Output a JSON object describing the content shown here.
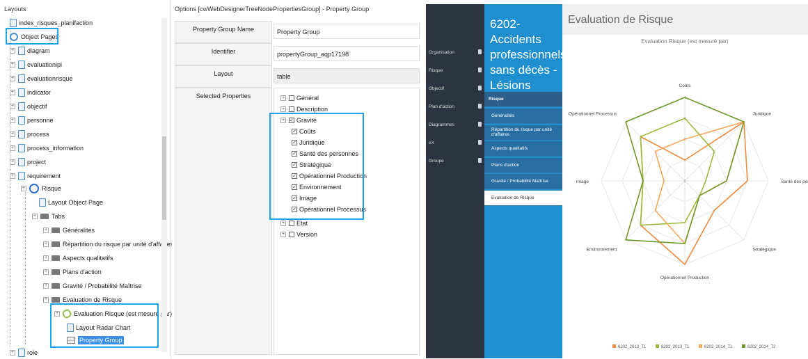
{
  "left_panel": {
    "header": "Layouts",
    "items": [
      {
        "label": "index_risques_planifaction"
      },
      {
        "label": "Object Pages"
      },
      {
        "label": "diagram"
      },
      {
        "label": "evaluationipi"
      },
      {
        "label": "evaluationrisque"
      },
      {
        "label": "indicator"
      },
      {
        "label": "objectif"
      },
      {
        "label": "personne"
      },
      {
        "label": "process"
      },
      {
        "label": "process_information"
      },
      {
        "label": "project"
      },
      {
        "label": "requirement"
      },
      {
        "label": "Risque"
      },
      {
        "label": "Layout Object Page"
      },
      {
        "label": "Tabs"
      },
      {
        "label": "Généralités"
      },
      {
        "label": "Répartition du risque par unité d'affaires"
      },
      {
        "label": "Aspects qualitatifs"
      },
      {
        "label": "Plans d'action"
      },
      {
        "label": "Gravité / Probabilité Maîtrise"
      },
      {
        "label": "Evaluation de Risque"
      },
      {
        "label": "Evaluation Risque (est mesuré par)"
      },
      {
        "label": "Layout Radar Chart"
      },
      {
        "label": "Property Group"
      },
      {
        "label": "role"
      }
    ]
  },
  "middle_panel": {
    "header": "Options [cwWebDesignerTreeNodePropertiesGroup] - Property Group",
    "fields": [
      {
        "label": "Property Group Name",
        "value": "Property Group"
      },
      {
        "label": "Identifier",
        "value": "propertyGroup_aqp17198"
      },
      {
        "label": "Layout",
        "value": "table"
      },
      {
        "label": "Selected Properties",
        "value": ""
      }
    ],
    "properties": [
      {
        "label": "Général",
        "checked": false
      },
      {
        "label": "Description",
        "checked": false
      },
      {
        "label": "Gravité",
        "checked": true
      },
      {
        "label": "Coûts",
        "checked": true
      },
      {
        "label": "Juridique",
        "checked": true
      },
      {
        "label": "Santé des personnes",
        "checked": true
      },
      {
        "label": "Stratégique",
        "checked": true
      },
      {
        "label": "Opérationnel Production",
        "checked": true
      },
      {
        "label": "Environnement",
        "checked": true
      },
      {
        "label": "Image",
        "checked": true
      },
      {
        "label": "Opérationnel Processus",
        "checked": true
      },
      {
        "label": "Etat",
        "checked": false
      },
      {
        "label": "Version",
        "checked": false
      }
    ]
  },
  "app": {
    "nav": [
      "Organisation",
      "Risque",
      "Objectif",
      "Plan d'action",
      "Diagrammes",
      "eX",
      "Groupe"
    ],
    "page_title": "6202-Accidents professionnels sans décès - Lésions légères",
    "section_header": "Risque",
    "tabs": [
      "Généralités",
      "Répartition du risque par unité d'affaires",
      "Aspects qualitatifs",
      "Plans d'action",
      "Gravité / Probabilité Maîtrise",
      "Evaluation de Risque"
    ],
    "main_title": "Evaluation de Risque"
  },
  "chart_data": {
    "type": "radar",
    "title": "Evaluation Risque (est mesuré par)",
    "axes": [
      "Coûts",
      "Juridique",
      "Santé des personnes",
      "Stratégique",
      "Opérationnel Production",
      "Environnement",
      "Image",
      "Opérationnel Processus"
    ],
    "ticks": [
      "0",
      "1",
      "2",
      "3",
      "4"
    ],
    "max": 4,
    "series": [
      {
        "name": "6202_2013_T1",
        "color": "#f08a3c",
        "values": [
          1,
          4,
          3,
          2,
          4,
          3,
          2,
          3
        ]
      },
      {
        "name": "6202_2013_T1",
        "color": "#9aba3a",
        "values": [
          3,
          2,
          1,
          1,
          2,
          3,
          2,
          3
        ]
      },
      {
        "name": "6202_2014_T1",
        "color": "#f5a85c",
        "values": [
          2,
          4,
          2,
          1,
          3,
          2,
          1,
          2
        ]
      },
      {
        "name": "6202_2014_T2",
        "color": "#6e9a2a",
        "values": [
          4,
          4,
          2,
          1,
          3,
          4,
          2,
          4
        ]
      }
    ]
  }
}
